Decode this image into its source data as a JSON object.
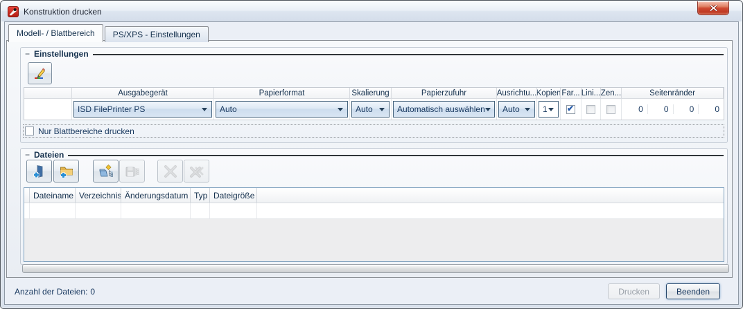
{
  "window": {
    "title": "Konstruktion drucken"
  },
  "ui": {
    "collapse_glyph": "−"
  },
  "tabs": [
    {
      "label": "Modell- / Blattbereich",
      "active": true
    },
    {
      "label": "PS/XPS - Einstellungen",
      "active": false
    }
  ],
  "settings": {
    "title": "Einstellungen",
    "columns": [
      "Ausgabegerät",
      "Papierformat",
      "Skalierung",
      "Papierzufuhr",
      "Ausrichtu...",
      "Kopien",
      "Far...",
      "Lini...",
      "Zen...",
      "Seitenränder"
    ],
    "row": {
      "output_device": "ISD FilePrinter PS",
      "paper_format": "Auto",
      "scaling": "Auto",
      "paper_feed": "Automatisch auswählen",
      "orientation": "Auto",
      "copies": "1",
      "color_checked": true,
      "lines_checked": false,
      "centered_checked": false,
      "margins": [
        "0",
        "0",
        "0",
        "0"
      ]
    },
    "sheet_only_label": "Nur Blattbereiche drucken",
    "sheet_only_checked": false
  },
  "files": {
    "title": "Dateien",
    "columns": [
      "Dateiname",
      "Verzeichnis",
      "Änderungsdatum",
      "Typ",
      "Dateigröße"
    ],
    "rows": [],
    "toolbar": {
      "add_file_disabled": false,
      "add_folder_disabled": false,
      "load_list_disabled": false,
      "save_list_disabled": true,
      "remove_disabled": true,
      "remove_all_disabled": true
    }
  },
  "footer": {
    "count_label": "Anzahl der Dateien:",
    "count_value": "0",
    "print_label": "Drucken",
    "print_disabled": true,
    "close_label": "Beenden"
  },
  "colors": {
    "accent_text": "#17375E",
    "close_button_red": "#CC4631",
    "combo_border": "#47657F",
    "list_border": "#7DA0BE",
    "caption_line": "#303539"
  }
}
